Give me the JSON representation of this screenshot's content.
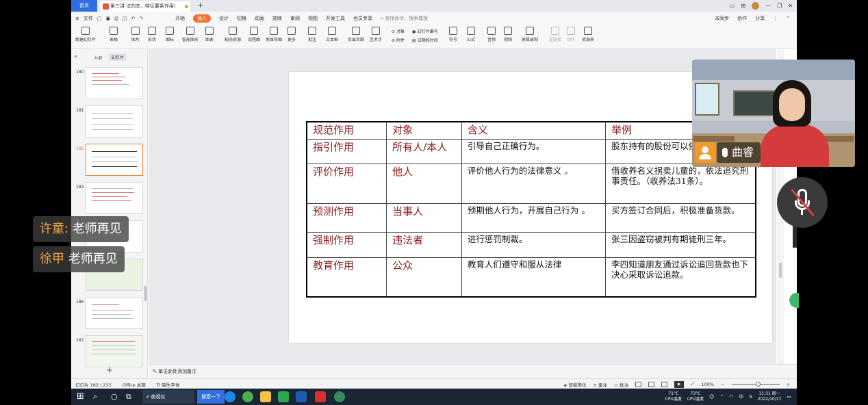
{
  "tabbar": {
    "home": "首页",
    "doc_title": "第三讲 法的本...特征要素作用)"
  },
  "menubar": {
    "file": "文件",
    "tabs": [
      "开始",
      "插入",
      "设计",
      "切换",
      "动画",
      "放映",
      "审阅",
      "视图",
      "开发工具",
      "会员专享"
    ],
    "active_tab": "插入",
    "search": "查找命令、搜索模板",
    "right": [
      "未同步",
      "协作",
      "分享"
    ]
  },
  "ribbon": {
    "buttons": [
      "新建幻灯片",
      "表格",
      "图片",
      "形状",
      "图标",
      "智能图形",
      "图表",
      "稻壳资源",
      "流程图",
      "思维导图",
      "更多",
      "批注",
      "文本框",
      "页眉页脚",
      "艺术字",
      "符号",
      "公式",
      "音频",
      "视频",
      "屏幕录制",
      "超链接",
      "动作",
      "资源夹"
    ],
    "small_buttons": [
      "对象",
      "幻灯片编号",
      "附件",
      "日期和时间"
    ]
  },
  "leftpane": {
    "tabs": [
      "大纲",
      "幻灯片"
    ],
    "thumb_numbers": [
      "180",
      "181",
      "182",
      "183",
      "186",
      "187"
    ]
  },
  "slide": {
    "table": {
      "headers": [
        "规范作用",
        "对象",
        "含义",
        "举例"
      ],
      "rows": [
        [
          "指引作用",
          "所有人/本人",
          "引导自己正确行为。",
          "股东持有的股份可以依法转让。"
        ],
        [
          "评价作用",
          "他人",
          "评价他人行为的法律意义 。",
          "借收养名义拐卖儿童的，依法追究刑事责任。（收养法31条）。"
        ],
        [
          "预测作用",
          "当事人",
          "预期他人行为，开展自己行为 。",
          "买方签订合同后，积极准备货款。"
        ],
        [
          "强制作用",
          "违法者",
          "进行惩罚制裁。",
          "张三因盗窃被判有期徒刑三年。"
        ],
        [
          "教育作用",
          "公众",
          "教育人们遵守和服从法律",
          "李四知道朋友通过诉讼追回货款也下决心采取诉讼追款。"
        ]
      ]
    }
  },
  "notes": "单击此处添加备注",
  "statusbar": {
    "slide_counter": "幻灯片 182 / 235",
    "theme": "Office 主题",
    "missing_font": "缺失字体",
    "smart_beautify": "智能美化",
    "notes": "备注",
    "comments": "批注",
    "zoom": "100%"
  },
  "video": {
    "name": "曲睿"
  },
  "chats": [
    {
      "name": "许童:",
      "message": "老师再见"
    },
    {
      "name": "徐甲",
      "message": "老师再见"
    }
  ],
  "taskbar": {
    "app_label": "夜视仪",
    "search_btn": "搜索一下",
    "cpu_temp": "71°C",
    "cpu_label": "CPU温度",
    "cpu_temp2": "73°C",
    "cpu_label2": "CPU温度",
    "ime": "中",
    "time": "11:31 周一",
    "date": "2022/10/17"
  },
  "colors": {
    "accent": "#f36f2e",
    "slide_text_red": "#8b1a1a",
    "taskbar": "#1b2635"
  }
}
